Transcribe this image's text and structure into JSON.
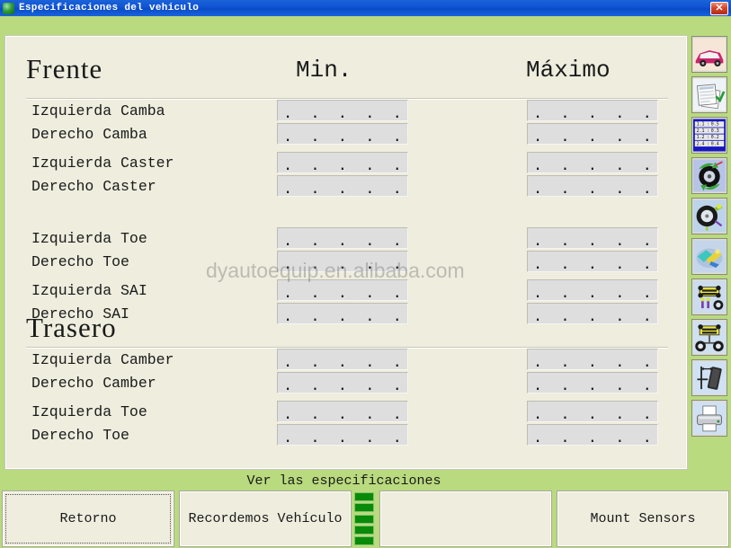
{
  "window": {
    "title": "Especificaciones del vehiculo",
    "icon": "globe-icon",
    "close_label": "✕"
  },
  "columns": {
    "min": "Min.",
    "max": "Máximo"
  },
  "sections": [
    {
      "title": "Frente",
      "rows": [
        {
          "label": "Izquierda Camba",
          "min": ". . . . .",
          "max": ". . . . ."
        },
        {
          "label": "Derecho Camba",
          "min": ". . . . .",
          "max": ". . . . ."
        },
        {
          "label": "Izquierda Caster",
          "min": ". . . . .",
          "max": ". . . . ."
        },
        {
          "label": "Derecho Caster",
          "min": ". . . . .",
          "max": ". . . . ."
        },
        {
          "label": "Izquierda Toe",
          "min": ". . . . .",
          "max": ". . . . ."
        },
        {
          "label": "Derecho Toe",
          "min": ". . . . .",
          "max": ". . . . ."
        },
        {
          "label": "Izquierda SAI",
          "min": ". . . . .",
          "max": ". . . . ."
        },
        {
          "label": "Derecho SAI",
          "min": ". . . . .",
          "max": ". . . . ."
        }
      ]
    },
    {
      "title": "Trasero",
      "rows": [
        {
          "label": "Izquierda Camber",
          "min": ". . . . .",
          "max": ". . . . ."
        },
        {
          "label": "Derecho Camber",
          "min": ". . . . .",
          "max": ". . . . ."
        },
        {
          "label": "Izquierda Toe",
          "min": ". . . . .",
          "max": ". . . . ."
        },
        {
          "label": "Derecho Toe",
          "min": ". . . . .",
          "max": ". . . . ."
        }
      ]
    }
  ],
  "watermark": "dyautoequip.en.alibaba.com",
  "toolbar": [
    {
      "name": "vehicle-selection-icon"
    },
    {
      "name": "spec-sheets-icon"
    },
    {
      "name": "measurement-table-icon"
    },
    {
      "name": "wheel-runout-icon"
    },
    {
      "name": "wheel-sensor-icon"
    },
    {
      "name": "steering-part-icon"
    },
    {
      "name": "chassis-front-icon"
    },
    {
      "name": "chassis-rear-icon"
    },
    {
      "name": "tire-gauge-icon"
    },
    {
      "name": "printer-icon"
    }
  ],
  "status": {
    "view_specifications": "Ver las especificaciones",
    "progress_segments": 5
  },
  "buttons": {
    "retorno": "Retorno",
    "recordar": "Recordemos Vehículo",
    "blank": "",
    "mount_sensors": "Mount Sensors"
  },
  "colors": {
    "background_green": "#b9da7e",
    "panel_cream": "#eeedde",
    "titlebar_blue": "#1155d4",
    "field_gray": "#dedede",
    "segment_green": "#0a8a09",
    "close_red": "#d6452c"
  }
}
